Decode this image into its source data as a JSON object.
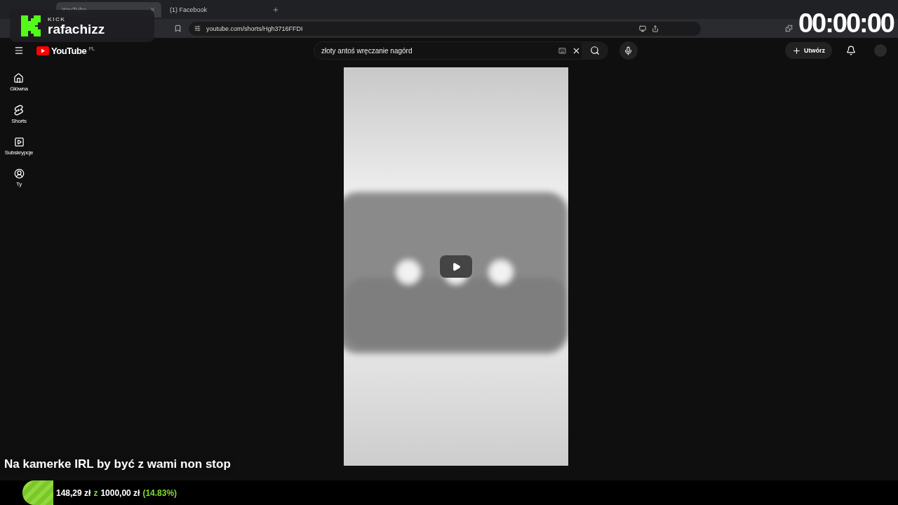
{
  "browser": {
    "tabs": [
      {
        "title": "YouTube",
        "selected": true
      },
      {
        "title": "(1) Facebook",
        "selected": false
      }
    ],
    "url": "youtube.com/shorts/Hgh3716FFDI"
  },
  "youtube": {
    "logo": "YouTube",
    "region": "PL",
    "search": {
      "value": "złoty antoś wręczanie nagórd"
    },
    "create_button": "Utwórz",
    "sidebar": [
      {
        "label": "Główna"
      },
      {
        "label": "Shorts"
      },
      {
        "label": "Subskrypcje"
      },
      {
        "label": "Ty"
      }
    ]
  },
  "stream_overlay": {
    "platform": "KICK",
    "channel": "rafachizz",
    "timer": "00:00:00",
    "goal_title": "Na kamerke IRL by być z wami non stop",
    "goal": {
      "current": "148,29 zł",
      "separator": "z",
      "target": "1000,00 zł",
      "percent": "(14.83%)"
    }
  }
}
